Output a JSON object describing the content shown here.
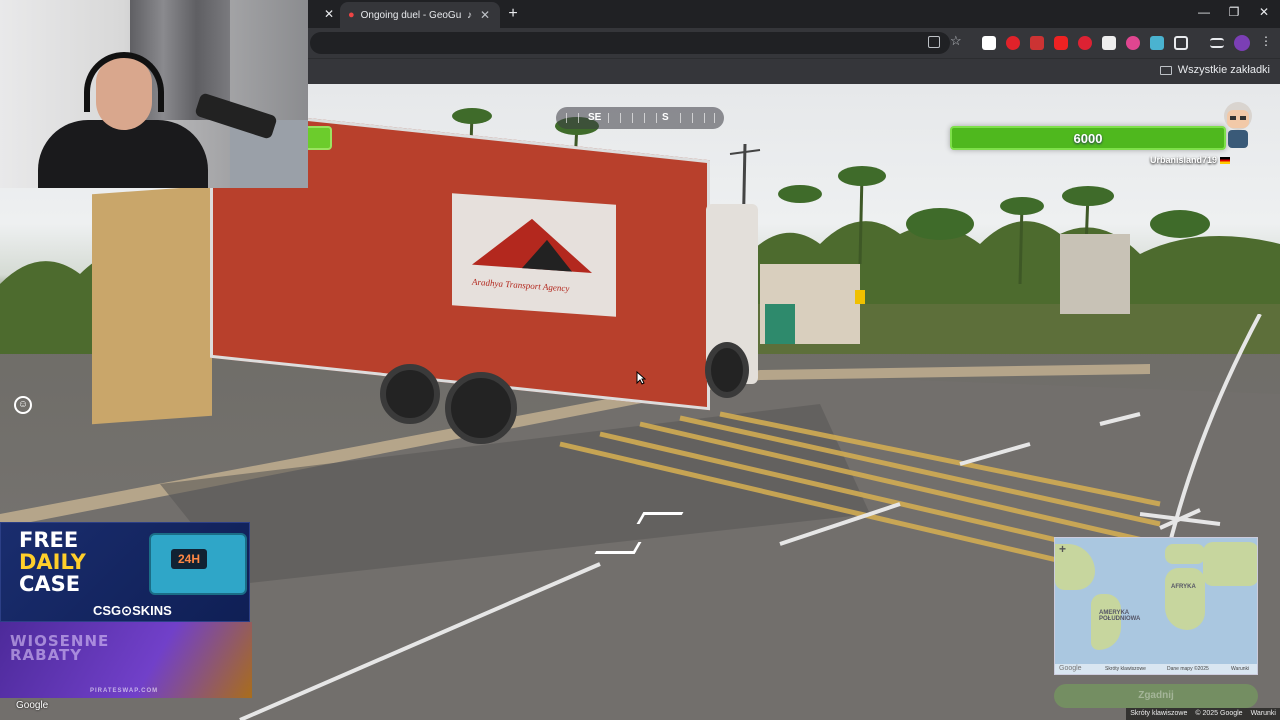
{
  "browser": {
    "active_tab_title": "Ongoing duel - GeoGuessr",
    "bookmarks_label": "Wszystkie zakładki"
  },
  "game": {
    "compass": {
      "left": "SE",
      "right": "S"
    },
    "health": 6000,
    "health_label": "6000",
    "player_name": "Urbanisland719",
    "player_flag": "Germany"
  },
  "minimap": {
    "labels": [
      "AMERYKA POŁUDNIOWA",
      "AFRYKA"
    ],
    "zoom_in": "+",
    "google": "Google",
    "shortcuts": "Skróty klawiszowe",
    "map_data": "Dane mapy ©2025",
    "terms": "Warunki"
  },
  "guess_button": "Zgadnij",
  "streetview": {
    "truck_text": "Aradhya Transport Agency",
    "google_logo": "Google",
    "bottom_shortcuts": "Skróty klawiszowe",
    "bottom_copyright": "© 2025 Google",
    "bottom_terms": "Warunki"
  },
  "ads": {
    "ad1": {
      "line1": "FREE",
      "line2": "DAILY",
      "line3": "CASE",
      "case_label": "24H",
      "brand": "CSG⊙SKINS"
    },
    "ad2": {
      "line1": "WIOSENNE",
      "line2": "RABATY",
      "footer": "PIRATESWAP.COM"
    }
  },
  "icons": [
    "tab-close-icon",
    "location-pin-icon",
    "speaker-icon",
    "new-tab-icon",
    "minimize-icon",
    "restore-icon",
    "close-window-icon",
    "star-icon",
    "extensions-icon",
    "profile-icon",
    "menu-icon",
    "folder-icon",
    "emoji-icon",
    "cursor-icon"
  ],
  "colors": {
    "health_bar": "#4fb81e",
    "truck": "#b8402c"
  }
}
